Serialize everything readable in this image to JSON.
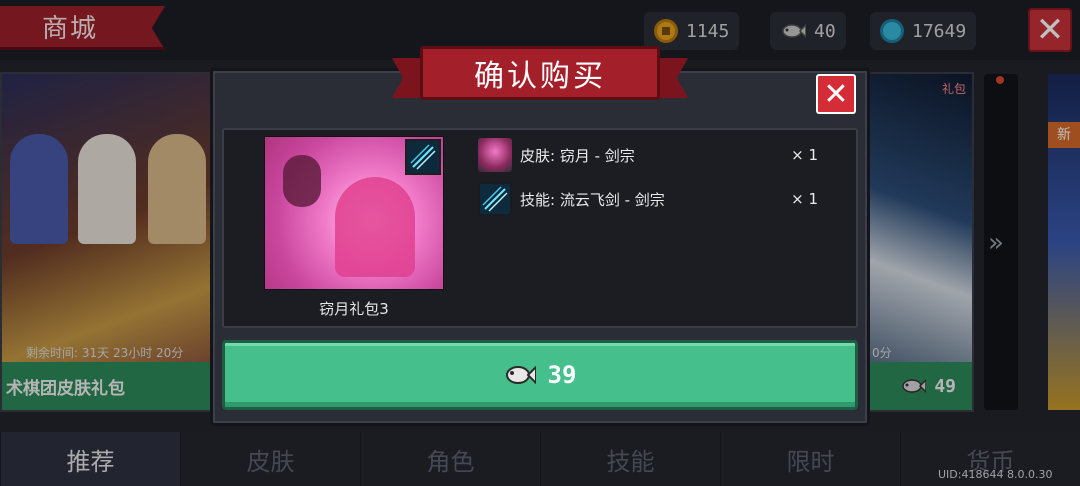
{
  "header": {
    "title": "商城",
    "currencies": [
      {
        "icon": "coin-icon",
        "value": "1145"
      },
      {
        "icon": "fish-icon",
        "value": "40"
      },
      {
        "icon": "gem-icon",
        "value": "17649"
      }
    ]
  },
  "cards": {
    "left": {
      "timer": "剩余时间: 31天 23小时 20分",
      "name": "术棋团皮肤礼包"
    },
    "right": {
      "tag": "礼包",
      "timer": "0分",
      "price": "49"
    },
    "far": {
      "badge": "新"
    }
  },
  "dialog": {
    "title": "确认购买",
    "pack_name": "窃月礼包3",
    "items": [
      {
        "icon": "skin-icon",
        "label": "皮肤: 窃月 - 剑宗",
        "qty": "× 1"
      },
      {
        "icon": "skill-icon",
        "label": "技能: 流云飞剑 - 剑宗",
        "qty": "× 1"
      }
    ],
    "price": "39"
  },
  "tabs": [
    {
      "label": "推荐",
      "active": true
    },
    {
      "label": "皮肤",
      "active": false
    },
    {
      "label": "角色",
      "active": false
    },
    {
      "label": "技能",
      "active": false
    },
    {
      "label": "限时",
      "active": false
    },
    {
      "label": "货币",
      "active": false
    }
  ],
  "footer": {
    "uid": "UID:418644 8.0.0.30"
  },
  "colors": {
    "ribbon_red": "#a31f2a",
    "buy_green": "#45c08c",
    "close_red": "#d52d38"
  }
}
